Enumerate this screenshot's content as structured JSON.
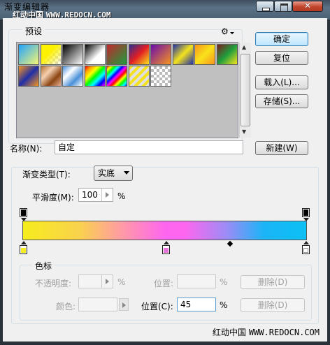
{
  "window": {
    "title": "渐变编辑器",
    "watermark_top_cn": "红动中国",
    "watermark_top_url": "WWW.REDOCN.COM"
  },
  "presets": {
    "legend": "预设",
    "menu_icon": "gear-icon",
    "swatches": [
      {
        "name": "preset-swatch-1",
        "bg": "linear-gradient(135deg,#1fa2ff,#f9f871)"
      },
      {
        "name": "preset-swatch-2",
        "bg": "linear-gradient(135deg,#fff200,#fff200 40%,rgba(255,255,255,0.2)),repeating-conic-gradient(#ccc 0 25%,#fff 0 50%) 0 0/8px 8px"
      },
      {
        "name": "preset-swatch-3",
        "bg": "linear-gradient(135deg,#000,#fff)"
      },
      {
        "name": "preset-swatch-4",
        "bg": "linear-gradient(135deg,#000,#fff 60%,#fff)"
      },
      {
        "name": "preset-swatch-5",
        "bg": "linear-gradient(135deg,#c1272d,#1b9e3e)"
      },
      {
        "name": "preset-swatch-6",
        "bg": "linear-gradient(135deg,#2b2d8f,#e31e24,#f7e31b)"
      },
      {
        "name": "preset-swatch-7",
        "bg": "linear-gradient(135deg,#6a0dad,#f7941d)"
      },
      {
        "name": "preset-swatch-8",
        "bg": "linear-gradient(135deg,#1f2fa8,#f4e21e,#1f2fa8)"
      },
      {
        "name": "preset-swatch-9",
        "bg": "linear-gradient(135deg,#f7941d,#f9e21a,#f7941d)"
      },
      {
        "name": "preset-swatch-10",
        "bg": "linear-gradient(135deg,#7b1e1e,#1e9e3e,#f7e31b)"
      },
      {
        "name": "preset-swatch-11",
        "bg": "linear-gradient(135deg,#f7941d,#1f2fa8,#f7941d)"
      },
      {
        "name": "preset-swatch-12",
        "bg": "linear-gradient(135deg,#b87333,#f5d0b0,#8b4513,#e8b090)"
      },
      {
        "name": "preset-swatch-13",
        "bg": "linear-gradient(135deg,#4a90d9,#fff,#4a90d9,#fff)"
      },
      {
        "name": "preset-swatch-14",
        "bg": "linear-gradient(135deg,red,orange,yellow,lime,cyan,blue,magenta)"
      },
      {
        "name": "preset-swatch-15",
        "bg": "repeating-linear-gradient(135deg,red 0,yellow 4px,lime 8px,cyan 12px,blue 16px,magenta 20px,red 24px)"
      },
      {
        "name": "preset-swatch-16",
        "bg": "repeating-linear-gradient(135deg,#f4e21e 0,#f4e21e 4px,rgba(255,255,255,0.5) 4px,rgba(255,255,255,0.5) 8px)"
      },
      {
        "name": "preset-swatch-17",
        "bg": "repeating-conic-gradient(#bbb 0 25%,#fff 0 50%) 0 0/8px 8px"
      }
    ]
  },
  "buttons": {
    "ok": "确定",
    "reset": "复位",
    "load": "载入(L)...",
    "save": "存储(S)...",
    "new": "新建(W)"
  },
  "name_field": {
    "label": "名称(N):",
    "value": "自定"
  },
  "gradient": {
    "type_label": "渐变类型(T):",
    "type_value": "实底",
    "smoothness_label": "平滑度(M):",
    "smoothness_value": "100",
    "smoothness_unit": "%"
  },
  "color_stops": {
    "legend": "色标",
    "opacity_label": "不透明度:",
    "opacity_value": "",
    "opacity_unit": "%",
    "opacity_location_label": "位置:",
    "opacity_location_unit": "%",
    "opacity_delete": "删除(D)",
    "color_label": "颜色:",
    "color_location_label": "位置(C):",
    "color_location_value": "45",
    "color_location_unit": "%",
    "color_delete": "删除(D)"
  },
  "watermark_bottom": {
    "cn": "红动中国",
    "url": "WWW.REDOCN.COM"
  },
  "colors": {
    "stop_left": "#f6ec1d",
    "stop_mid": "#e873dd",
    "stop_right": "#ffffff"
  }
}
